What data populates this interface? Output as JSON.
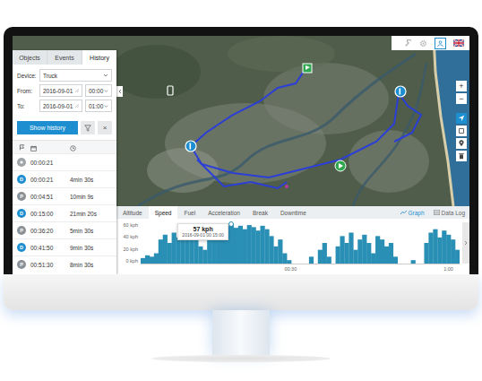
{
  "left_panel": {
    "tabs": [
      {
        "label": "Objects",
        "selected": false
      },
      {
        "label": "Events",
        "selected": false
      },
      {
        "label": "History",
        "selected": true
      }
    ],
    "fields": [
      {
        "label": "Device:",
        "kind": "select",
        "value": "Truck"
      },
      {
        "label": "From:",
        "kind": "datetime",
        "date": "2016-09-01",
        "time": "00:00"
      },
      {
        "label": "To:",
        "kind": "datetime",
        "date": "2016-09-01",
        "time": "01:00"
      }
    ],
    "show_history_button": "Show history",
    "clear_button": "×",
    "history": {
      "rows": [
        {
          "kind": "start",
          "time": "00:00:21",
          "color": "#9ea5ab"
        },
        {
          "kind": "drive",
          "badge": "D",
          "time": "00:00:21",
          "duration": "4min 30s",
          "color": "#1d8fd1"
        },
        {
          "kind": "park",
          "badge": "P",
          "time": "00:04:51",
          "duration": "10min 9s",
          "color": "#8a9197"
        },
        {
          "kind": "drive",
          "badge": "D",
          "time": "00:15:00",
          "duration": "21min 20s",
          "color": "#1d8fd1"
        },
        {
          "kind": "park",
          "badge": "P",
          "time": "00:36:20",
          "duration": "5min 30s",
          "color": "#8a9197"
        },
        {
          "kind": "drive",
          "badge": "D",
          "time": "00:41:50",
          "duration": "9min 30s",
          "color": "#1d8fd1"
        },
        {
          "kind": "park",
          "badge": "P",
          "time": "00:51:30",
          "duration": "8min 30s",
          "color": "#8a9197"
        }
      ]
    }
  },
  "map": {
    "controls": {
      "zoom_in": "+",
      "zoom_out": "−"
    }
  },
  "chart": {
    "tabs": [
      {
        "label": "Altitude",
        "selected": false
      },
      {
        "label": "Speed",
        "selected": true
      },
      {
        "label": "Fuel",
        "selected": false
      },
      {
        "label": "Acceleration",
        "selected": false
      },
      {
        "label": "Break",
        "selected": false
      },
      {
        "label": "Downtime",
        "selected": false
      }
    ],
    "views": [
      {
        "label": "Graph",
        "selected": true
      },
      {
        "label": "Data Log",
        "selected": false
      }
    ],
    "y_ticks": [
      "60 kph",
      "40 kph",
      "20 kph",
      "0 kph"
    ],
    "x_ticks": [
      "00:30",
      "1:00"
    ],
    "series": [
      {
        "values": [
          8,
          12,
          10,
          15,
          35,
          42,
          30,
          45,
          38,
          44,
          40,
          36,
          42,
          25,
          20,
          45,
          40,
          50,
          48,
          55,
          57,
          52,
          55,
          50,
          56,
          53,
          48,
          55,
          50,
          40,
          25,
          35,
          15,
          5,
          0,
          0,
          0,
          0,
          10,
          0,
          20,
          30,
          10,
          0,
          25,
          40,
          30,
          45,
          20,
          35,
          42,
          30,
          15,
          40,
          35,
          25,
          30,
          10,
          0,
          0,
          0,
          5,
          0,
          0,
          30,
          45,
          50,
          38,
          48,
          42,
          35,
          20
        ]
      }
    ],
    "tooltip": {
      "value": "57 kph",
      "time": "2016-09-01 00:15:00",
      "point_index": 20
    }
  }
}
